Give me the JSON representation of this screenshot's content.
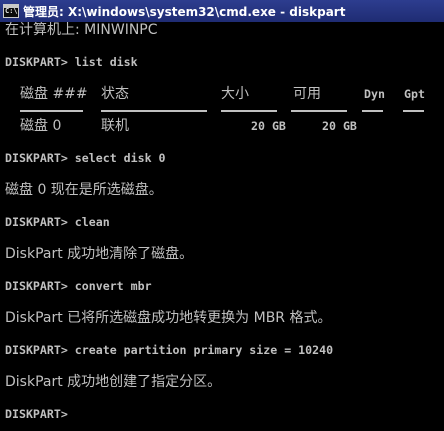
{
  "window": {
    "title": "管理员: X:\\windows\\system32\\cmd.exe - diskpart",
    "icon": "cmd-icon"
  },
  "console": {
    "computer_line": "在计算机上: MINWINPC",
    "cmd_list": "DISKPART> list disk",
    "table": {
      "headers": [
        "磁盘 ###",
        "状态",
        "大小",
        "可用",
        "Dyn",
        "Gpt"
      ],
      "row": [
        "磁盘 0",
        "联机",
        "20 GB",
        "20 GB",
        "",
        ""
      ]
    },
    "cmd_select": "DISKPART> select disk 0",
    "msg_select": "磁盘 0 现在是所选磁盘。",
    "cmd_clean": "DISKPART> clean",
    "msg_clean": "DiskPart 成功地清除了磁盘。",
    "cmd_convert": "DISKPART> convert mbr",
    "msg_convert": "DiskPart 已将所选磁盘成功地转更换为 MBR 格式。",
    "cmd_create": "DISKPART> create partition primary size = 10240",
    "msg_create": "DiskPart 成功地创建了指定分区。",
    "prompt": "DISKPART> "
  },
  "colors": {
    "background": "#000000",
    "text": "#c0c0c0",
    "titlebar": "#2d3d8f"
  }
}
